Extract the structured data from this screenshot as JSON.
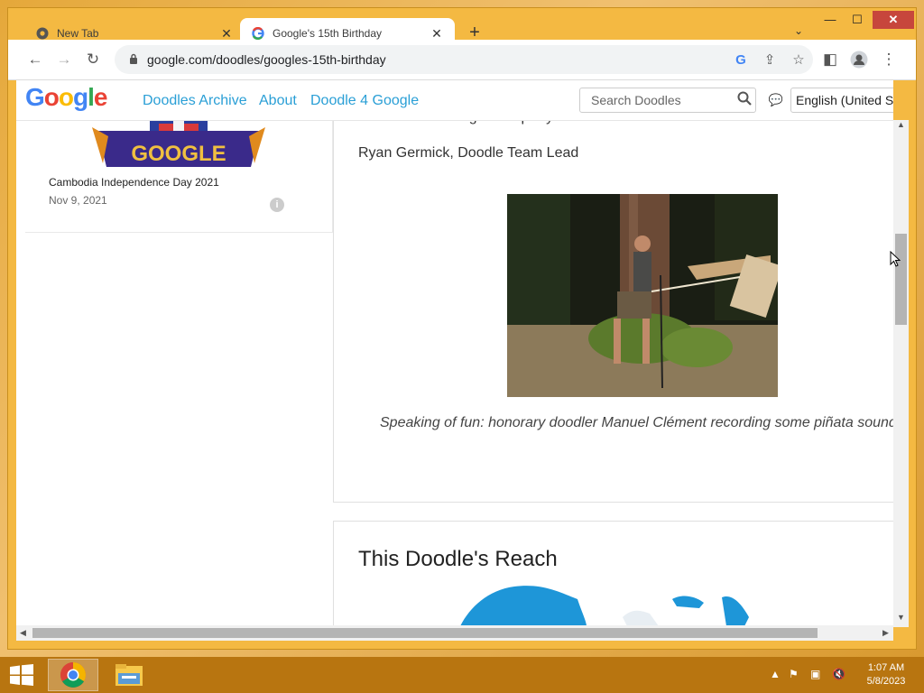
{
  "browser": {
    "tabs": [
      {
        "label": "New Tab",
        "icon": "chrome-icon"
      },
      {
        "label": "Google's 15th Birthday",
        "icon": "google-icon"
      }
    ],
    "window_controls": {
      "minimize": "—",
      "maximize": "☐",
      "close": "✕"
    },
    "new_tab": "+",
    "tab_menu": "⌄",
    "nav": {
      "back": "←",
      "forward": "→",
      "reload": "↻",
      "menu": "⋮"
    },
    "url": "google.com/doodles/googles-15th-birthday"
  },
  "page": {
    "logo": "Google",
    "nav_links": [
      "Doodles Archive",
      "About",
      "Doodle 4 Google"
    ],
    "search_placeholder": "Search Doodles",
    "language": "English (United States)",
    "sidebar_card": {
      "logo_text": "GOOGLE",
      "title": "Cambodia Independence Day 2021",
      "date": "Nov 9, 2021",
      "info": "i"
    },
    "article": {
      "thanks": "Thanks for coming to the party!",
      "author": "Ryan Germick, Doodle Team Lead",
      "caption": "Speaking of fun: honorary doodler Manuel Clément recording some piñata sound ..."
    },
    "reach_title": "This Doodle's Reach"
  },
  "taskbar": {
    "clock_time": "1:07 AM",
    "clock_date": "5/8/2023"
  },
  "colors": {
    "link": "#2a9fd6",
    "window_frame": "#f4b942",
    "taskbar": "#b87510",
    "map": "#1e96d8"
  }
}
